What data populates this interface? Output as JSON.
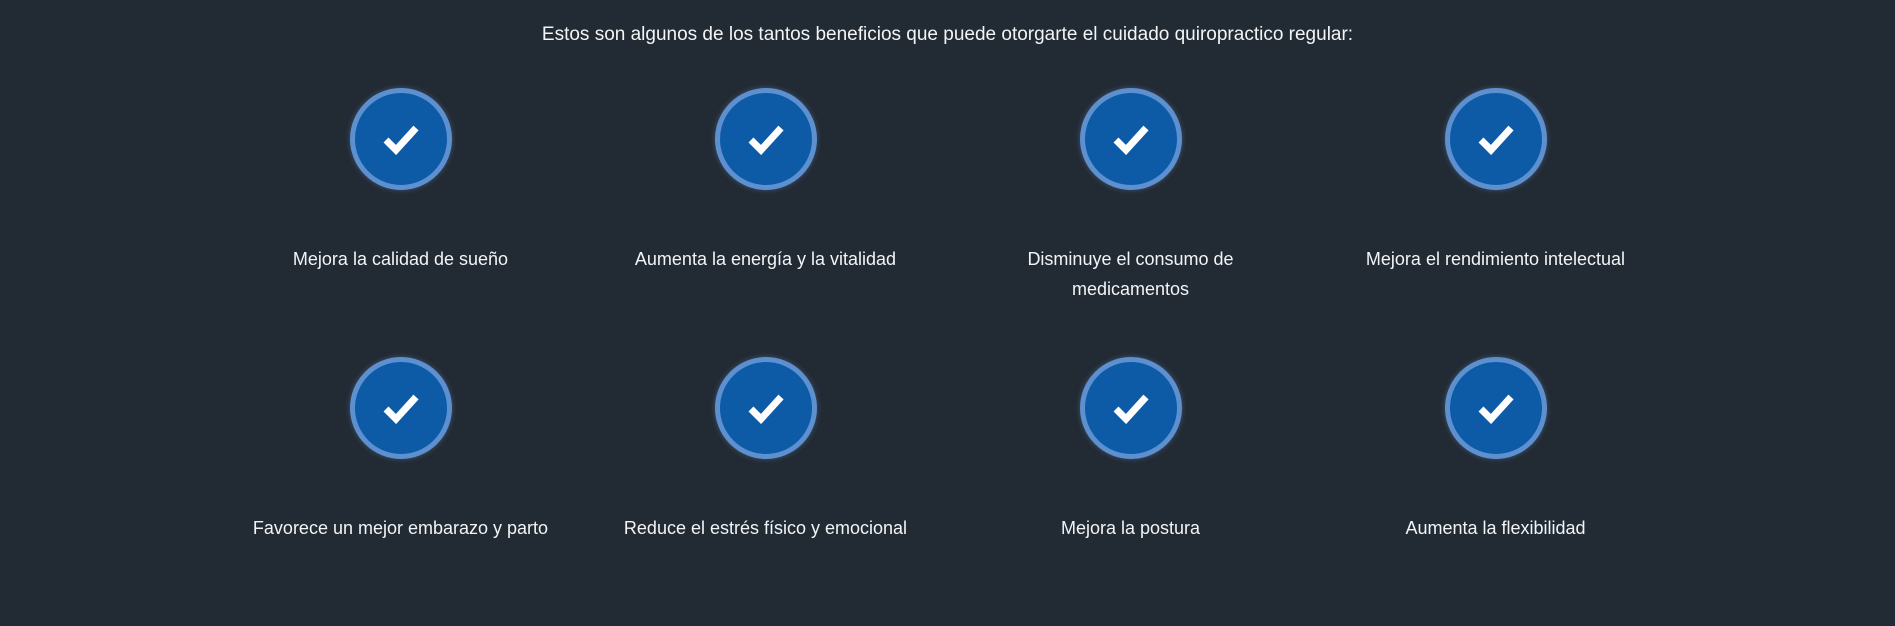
{
  "intro_text": "Estos son algunos de los tantos beneficios que puede otorgarte el cuidado quiropractico regular:",
  "colors": {
    "background": "#222a34",
    "circle_fill": "#0d5aa7",
    "circle_ring": "#5d90cf",
    "text": "#f2f4f6"
  },
  "benefits": [
    {
      "icon": "check-icon",
      "label": "Mejora la calidad de sueño"
    },
    {
      "icon": "check-icon",
      "label": "Aumenta la energía y la vitalidad"
    },
    {
      "icon": "check-icon",
      "label": "Disminuye el consumo de medicamentos"
    },
    {
      "icon": "check-icon",
      "label": "Mejora el rendimiento intelectual"
    },
    {
      "icon": "check-icon",
      "label": "Favorece un mejor embarazo y parto"
    },
    {
      "icon": "check-icon",
      "label": "Reduce el estrés físico y emocional"
    },
    {
      "icon": "check-icon",
      "label": "Mejora la postura"
    },
    {
      "icon": "check-icon",
      "label": "Aumenta la flexibilidad"
    }
  ]
}
